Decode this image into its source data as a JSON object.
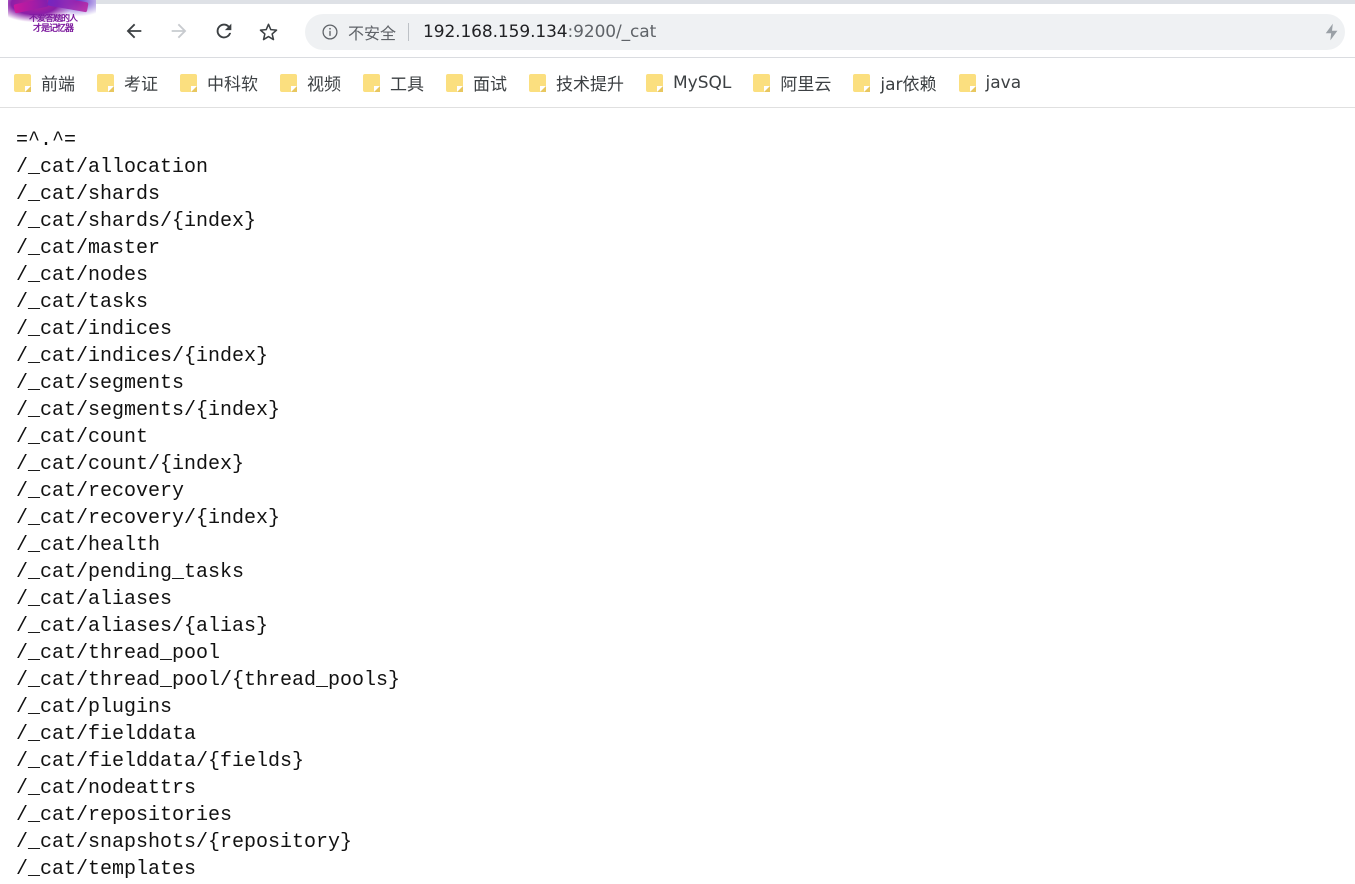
{
  "browser": {
    "tab": {
      "favicon_name": "site-favicon",
      "favicon_text_line1": "不爱答题的人",
      "favicon_text_line2": "才是记忆器"
    },
    "nav": {
      "back_label": "back-arrow-icon",
      "forward_label": "forward-arrow-icon",
      "reload_label": "reload-icon",
      "bookmark_star_label": "star-icon"
    },
    "omnibox": {
      "info_icon": "info-circle-icon",
      "security_text": "不安全",
      "url_host": "192.168.159.134",
      "url_rest": ":9200/_cat",
      "full_url": "192.168.159.134:9200/_cat",
      "bolt_icon": "lightning-bolt-icon"
    },
    "bookmarks": [
      {
        "label": "前端"
      },
      {
        "label": "考证"
      },
      {
        "label": "中科软"
      },
      {
        "label": "视频"
      },
      {
        "label": "工具"
      },
      {
        "label": "面试"
      },
      {
        "label": "技术提升"
      },
      {
        "label": "MySQL"
      },
      {
        "label": "阿里云"
      },
      {
        "label": "jar依赖"
      },
      {
        "label": "java"
      }
    ]
  },
  "content": {
    "lines": [
      "=^.^=",
      "/_cat/allocation",
      "/_cat/shards",
      "/_cat/shards/{index}",
      "/_cat/master",
      "/_cat/nodes",
      "/_cat/tasks",
      "/_cat/indices",
      "/_cat/indices/{index}",
      "/_cat/segments",
      "/_cat/segments/{index}",
      "/_cat/count",
      "/_cat/count/{index}",
      "/_cat/recovery",
      "/_cat/recovery/{index}",
      "/_cat/health",
      "/_cat/pending_tasks",
      "/_cat/aliases",
      "/_cat/aliases/{alias}",
      "/_cat/thread_pool",
      "/_cat/thread_pool/{thread_pools}",
      "/_cat/plugins",
      "/_cat/fielddata",
      "/_cat/fielddata/{fields}",
      "/_cat/nodeattrs",
      "/_cat/repositories",
      "/_cat/snapshots/{repository}",
      "/_cat/templates"
    ]
  },
  "colors": {
    "omnibox_bg": "#eff1f3",
    "folder_yellow": "#fbdf7f",
    "text_dark": "#202124",
    "text_gray": "#5f6368",
    "page_text": "#111111"
  }
}
